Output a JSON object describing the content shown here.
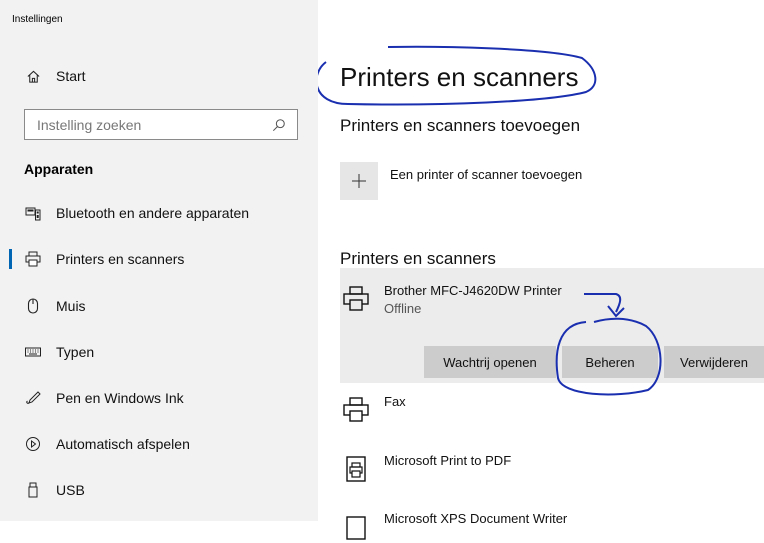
{
  "window": {
    "title": "Instellingen"
  },
  "sidebar": {
    "home": {
      "label": "Start",
      "icon": "home-icon"
    },
    "search": {
      "placeholder": "Instelling zoeken",
      "value": ""
    },
    "section": "Apparaten",
    "items": [
      {
        "label": "Bluetooth en andere apparaten",
        "icon": "bluetooth-devices-icon",
        "active": false
      },
      {
        "label": "Printers en scanners",
        "icon": "printer-icon",
        "active": true
      },
      {
        "label": "Muis",
        "icon": "mouse-icon",
        "active": false
      },
      {
        "label": "Typen",
        "icon": "keyboard-icon",
        "active": false
      },
      {
        "label": "Pen en Windows Ink",
        "icon": "pen-icon",
        "active": false
      },
      {
        "label": "Automatisch afspelen",
        "icon": "autoplay-icon",
        "active": false
      },
      {
        "label": "USB",
        "icon": "usb-icon",
        "active": false
      }
    ]
  },
  "main": {
    "title": "Printers en scanners",
    "add_section_title": "Printers en scanners toevoegen",
    "add_button_label": "Een printer of scanner toevoegen",
    "list_section_title": "Printers en scanners",
    "printers": [
      {
        "name": "Brother MFC-J4620DW Printer",
        "status": "Offline",
        "selected": true
      },
      {
        "name": "Fax",
        "status": "",
        "selected": false
      },
      {
        "name": "Microsoft Print to PDF",
        "status": "",
        "selected": false
      },
      {
        "name": "Microsoft XPS Document Writer",
        "status": "",
        "selected": false
      }
    ],
    "actions": {
      "open_queue": "Wachtrij openen",
      "manage": "Beheren",
      "remove": "Verwijderen"
    }
  },
  "annotations": {
    "color": "#1a2fb0"
  }
}
